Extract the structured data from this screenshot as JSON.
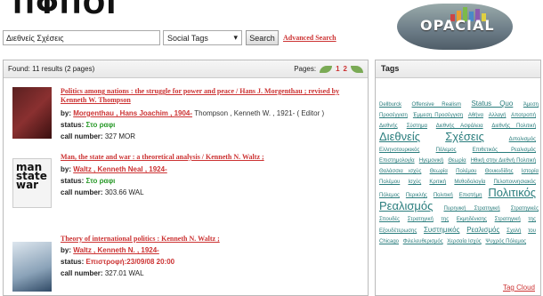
{
  "header": {
    "title_fragment": "ΠΦΠΟΙ",
    "logo_text": "OPACIAL"
  },
  "search": {
    "query": "Διεθνείς Σχέσεις",
    "field": "Social Tags",
    "button": "Search",
    "advanced": "Advanced Search"
  },
  "results": {
    "summary": "Found: 11 results (2 pages)",
    "pages_label": "Pages:",
    "pages": [
      "1",
      "2"
    ],
    "items": [
      {
        "title": "Politics among nations : the struggle for power and peace / Hans J. Morgenthau ; revised by Kenneth W. Thompson",
        "by_label": "by:",
        "author": "Morgenthau , Hans Joachim , 1904-",
        "contrib": "Thompson , Kenneth W. , 1921- ( Editor )",
        "status_label": "status:",
        "status": "Στο ραφι",
        "call_label": "call number:",
        "call": "327 MOR"
      },
      {
        "title": "Man, the state and war : a theoretical analysis / Kenneth N. Waltz ;",
        "by_label": "by:",
        "author": "Waltz , Kenneth Neal , 1924-",
        "contrib": "",
        "status_label": "status:",
        "status": "Στο ραφι",
        "call_label": "call number:",
        "call": "303.66 WAL"
      },
      {
        "title": "Theory of international politics : Kenneth N. Waltz ;",
        "by_label": "by:",
        "author": "Waltz , Kenneth N. , 1924-",
        "contrib": "",
        "status_label": "status:",
        "status": "Επιστροφή:23/09/08 20:00",
        "call_label": "call number:",
        "call": "327.01 WAL"
      }
    ]
  },
  "tags": {
    "title": "Tags",
    "cloud": [
      {
        "t": "Dellburck",
        "s": 1
      },
      {
        "t": "Offensive Realism",
        "s": 1
      },
      {
        "t": "Status Quo",
        "s": 2
      },
      {
        "t": "Άμεση Προσέγγιση",
        "s": 1
      },
      {
        "t": "Έμμεση Προσέγγιση",
        "s": 1
      },
      {
        "t": "Αθήνα",
        "s": 1
      },
      {
        "t": "Αλλαγή",
        "s": 1
      },
      {
        "t": "Αποτροπή",
        "s": 1
      },
      {
        "t": "Διεθνής",
        "s": 1
      },
      {
        "t": "Σύστημα",
        "s": 1
      },
      {
        "t": "Διεθνής Ασφάλεια",
        "s": 1
      },
      {
        "t": "Διεθνής Πολιτική",
        "s": 1
      },
      {
        "t": "Διεθνείς",
        "s": 4
      },
      {
        "t": "Σχέσεις",
        "s": 4
      },
      {
        "t": "Διπολισμός",
        "s": 1
      },
      {
        "t": "Ελληνοτουρκικός",
        "s": 1
      },
      {
        "t": "Πόλεμος",
        "s": 1
      },
      {
        "t": "Επιθετικός Ρεαλισμός",
        "s": 1
      },
      {
        "t": "Επιστημολογία",
        "s": 1
      },
      {
        "t": "Ηγεμονική",
        "s": 1
      },
      {
        "t": "Θεωρία",
        "s": 1
      },
      {
        "t": "Ηθική στην Διεθνή Πολιτική",
        "s": 1
      },
      {
        "t": "Θαλάσσια ισχύς",
        "s": 1
      },
      {
        "t": "Θεωρία",
        "s": 1
      },
      {
        "t": "Πολέμου",
        "s": 1
      },
      {
        "t": "Θουκυδίδης",
        "s": 1
      },
      {
        "t": "Ιστορία Πολέμου",
        "s": 1
      },
      {
        "t": "Ισχύς",
        "s": 1
      },
      {
        "t": "Κριτική",
        "s": 1
      },
      {
        "t": "Μεθοδολογία",
        "s": 1
      },
      {
        "t": "Πελοποννησιακός",
        "s": 1
      },
      {
        "t": "Πόλεμος",
        "s": 1
      },
      {
        "t": "Περικλής",
        "s": 1
      },
      {
        "t": "Πολιτική",
        "s": 1
      },
      {
        "t": "Επιστήμη",
        "s": 1
      },
      {
        "t": "Πολιτικός",
        "s": 4
      },
      {
        "t": "Ρεαλισμός",
        "s": 4
      },
      {
        "t": "Πυρηνική Στρατηγική",
        "s": 1
      },
      {
        "t": "Στρατηγικές Σπουδές",
        "s": 1
      },
      {
        "t": "Στρατηγική",
        "s": 1
      },
      {
        "t": "της",
        "s": 1
      },
      {
        "t": "Εκμηδένισης",
        "s": 1
      },
      {
        "t": "Στρατηγική",
        "s": 1
      },
      {
        "t": "της",
        "s": 1
      },
      {
        "t": "Εξουδέτερωσης",
        "s": 1
      },
      {
        "t": "Συστημικός",
        "s": 2
      },
      {
        "t": "Ρεαλισμός",
        "s": 2
      },
      {
        "t": "Σχολή",
        "s": 1
      },
      {
        "t": "του",
        "s": 1
      },
      {
        "t": "Chicago",
        "s": 1
      },
      {
        "t": "Φιλελευθερισμός",
        "s": 1
      },
      {
        "t": "Χερσαία Ισχύς",
        "s": 1
      },
      {
        "t": "Ψυχρός Πόλεμος",
        "s": 1
      }
    ],
    "cloud_link": "Tag Cloud"
  },
  "colors": {
    "accent": "#cc3333",
    "tag": "#2a7d7d",
    "status_green": "#2a9a2a"
  }
}
